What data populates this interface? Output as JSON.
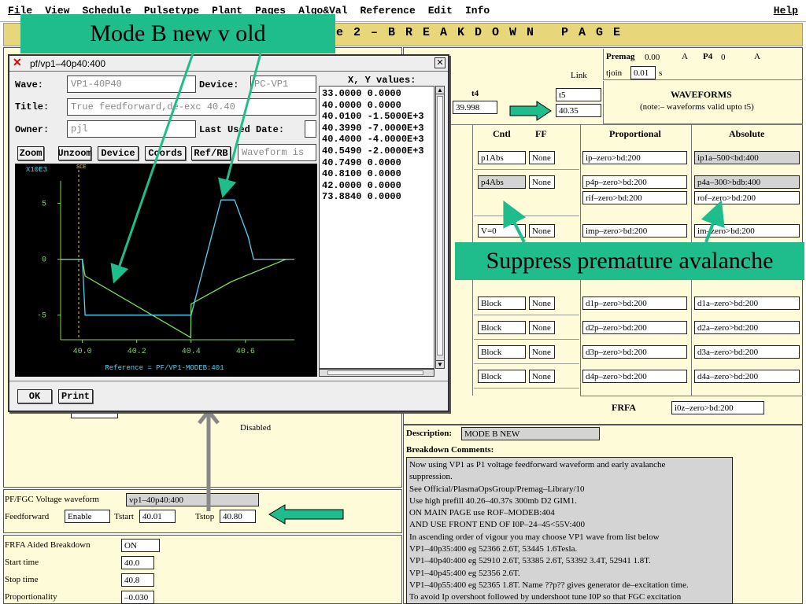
{
  "menu": {
    "items": [
      "File",
      "View",
      "Schedule",
      "Pulsetype",
      "Plant",
      "Pages",
      "Algo&Val",
      "Reference",
      "Edit",
      "Info"
    ],
    "help": "Help"
  },
  "page_title": "e 2 – B R E A K D O W N   P A G E",
  "callouts": {
    "mode_b": "Mode B new v old",
    "suppress": "Suppress premature avalanche"
  },
  "premag": {
    "label": "Premag",
    "value": "0.00",
    "unit": "A",
    "p4_label": "P4",
    "p4_value": "0",
    "p4_unit": "A",
    "tjoin_label": "tjoin",
    "tjoin_value": "0.01",
    "tjoin_unit": "s"
  },
  "link": {
    "label": "Link",
    "t4_label": "t4",
    "t4_value": "39.998",
    "t5_value": "t5",
    "t5_time": "40.35"
  },
  "waveforms": {
    "title": "WAVEFORMS",
    "note": "(note:– waveforms valid upto t5)"
  },
  "columns": {
    "cntl": "Cntl",
    "ff": "FF",
    "proportional": "Proportional",
    "absolute": "Absolute"
  },
  "rows": [
    {
      "cntl": "p1Abs",
      "cntl_grey": false,
      "ff": "None",
      "prop": [
        "ip–zero>bd:200"
      ],
      "abs": [
        "ip1a–500<bd:400"
      ],
      "abs_grey": true
    },
    {
      "cntl": "p4Abs",
      "cntl_grey": true,
      "ff": "None",
      "prop": [
        "p4p–zero>bd:200",
        "rif–zero>bd:200"
      ],
      "abs": [
        "p4a–300>bdb:400",
        "rof–zero>bd:200"
      ],
      "abs_grey": true
    },
    {
      "cntl": "V=0",
      "cntl_grey": false,
      "ff": "None",
      "prop": [
        "imp–zero>bd:200"
      ],
      "abs": [
        "im–zero>bd:200"
      ],
      "abs_grey": false
    },
    {
      "cntl": "Block",
      "cntl_grey": false,
      "ff": "None",
      "prop": [
        "d1p–zero>bd:200"
      ],
      "abs": [
        "d1a–zero>bd:200"
      ],
      "abs_grey": false
    },
    {
      "cntl": "Block",
      "cntl_grey": false,
      "ff": "None",
      "prop": [
        "d2p–zero>bd:200"
      ],
      "abs": [
        "d2a–zero>bd:200"
      ],
      "abs_grey": false
    },
    {
      "cntl": "Block",
      "cntl_grey": false,
      "ff": "None",
      "prop": [
        "d3p–zero>bd:200"
      ],
      "abs": [
        "d3a–zero>bd:200"
      ],
      "abs_grey": false
    },
    {
      "cntl": "Block",
      "cntl_grey": false,
      "ff": "None",
      "prop": [
        "d4p–zero>bd:200"
      ],
      "abs": [
        "d4a–zero>bd:200"
      ],
      "abs_grey": false
    }
  ],
  "frfa": {
    "label": "FRFA",
    "value": "i0z–zero>bd:200"
  },
  "disabled": "Disabled",
  "description": {
    "label": "Description:",
    "value": "MODE B NEW"
  },
  "comments": {
    "label": "Breakdown Comments:",
    "lines": [
      "Now using VP1 as P1 voltage feedforward waveform and early avalanche",
      "suppression.",
      "See Official/PlasmaOpsGroup/Premag–Library/10",
      "Use high prefill 40.26–40.37s 300mb D2 GIM1.",
      "ON MAIN PAGE use ROF–MODEB:404",
      "AND USE FRONT END OF I0P–24–45<55V:400",
      "In ascending order of vigour  you may choose VP1 wave from list below",
      "VP1–40p35:400 eg 52366 2.6T, 53445 1.6Tesla.",
      "VP1–40p40:400 eg  52910 2.6T, 53385 2.6T, 53392 3.4T, 52941 1.8T.",
      "VP1–40p45:400 eg 52356 2.6T.",
      "VP1–40p55:400 eg 52365  1.8T.    Name ??p?? gives generator de–excitation time.",
      "To avoid Ip overshoot followed by undershoot tune I0P so that FGC excitation"
    ]
  },
  "voltage": {
    "label": "PF/FGC Voltage waveform",
    "value": "vp1–40p40:400",
    "ff_label": "Feedforward",
    "ff_value": "Enable",
    "tstart_label": "Tstart",
    "tstart_value": "40.01",
    "tstop_label": "Tstop",
    "tstop_value": "40.80"
  },
  "frfa_aided": {
    "label": "FRFA Aided Breakdown",
    "value": "ON",
    "start_label": "Start time",
    "start_value": "40.0",
    "stop_label": "Stop time",
    "stop_value": "40.8",
    "prop_label": "Proportionality",
    "prop_value": "–0.030"
  },
  "dialog": {
    "title": "pf/vp1–40p40:400",
    "wave_label": "Wave:",
    "wave_value": "VP1-40P40",
    "device_label": "Device:",
    "device_value": "PC-VP1",
    "title_label": "Title:",
    "title_value": "True feedforward,de-exc 40.40",
    "owner_label": "Owner:",
    "owner_value": "pjl",
    "lastused_label": "Last Used Date:",
    "buttons": [
      "Zoom",
      "Unzoom",
      "Device",
      "Coords",
      "Ref/RB"
    ],
    "wave_is": "Waveform is",
    "xy_header": "X, Y values:",
    "xy": [
      [
        "33.0000",
        "0.0000"
      ],
      [
        "40.0000",
        "0.0000"
      ],
      [
        "40.0100",
        "-1.5000E+3"
      ],
      [
        "40.3990",
        "-7.0000E+3"
      ],
      [
        "40.4000",
        "-4.0000E+3"
      ],
      [
        "40.5490",
        "-2.0000E+3"
      ],
      [
        "40.7490",
        "0.0000"
      ],
      [
        "40.8100",
        "0.0000"
      ],
      [
        "42.0000",
        "0.0000"
      ],
      [
        "73.8840",
        "0.0000"
      ]
    ],
    "ok": "OK",
    "print": "Print"
  },
  "plot": {
    "ylabel_mult": "X10E3",
    "marker": "SCE",
    "reference": "Reference = PF/VP1-MODEB:401",
    "bg": "#000000",
    "new_color": "#4fd3f5",
    "old_color": "#7ed957"
  },
  "chart_data": {
    "type": "line",
    "xlim": [
      39.92,
      40.78
    ],
    "ylim": [
      -7.2,
      7.0
    ],
    "xticks": [
      "40.0",
      "40.2",
      "40.4",
      "40.6"
    ],
    "yticks": [
      "5",
      "0",
      "-5"
    ],
    "series": [
      {
        "x": [
          39.92,
          40.0,
          40.01,
          40.399,
          40.4,
          40.549,
          40.749,
          40.78
        ],
        "y": [
          0,
          0,
          -1.5,
          -7.0,
          -4.0,
          -2.0,
          0,
          0
        ]
      },
      {
        "x": [
          39.92,
          40.0,
          40.01,
          40.4,
          40.51,
          40.56,
          40.61,
          40.63,
          40.76
        ],
        "y": [
          0,
          0,
          -5.0,
          -5.0,
          5.3,
          5.3,
          2.0,
          0,
          0
        ]
      }
    ]
  }
}
